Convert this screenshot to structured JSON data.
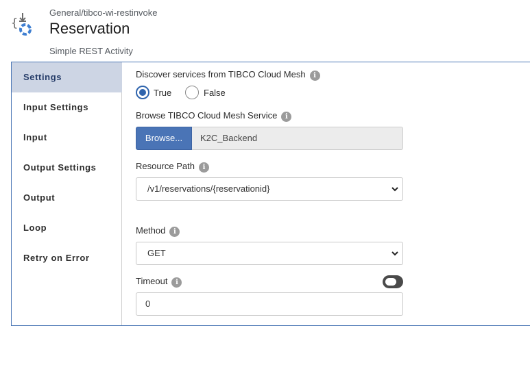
{
  "header": {
    "breadcrumb": "General/tibco-wi-restinvoke",
    "title": "Reservation",
    "subtitle": "Simple REST Activity"
  },
  "sidebar": {
    "items": [
      {
        "label": "Settings",
        "active": true
      },
      {
        "label": "Input Settings",
        "active": false
      },
      {
        "label": "Input",
        "active": false
      },
      {
        "label": "Output Settings",
        "active": false
      },
      {
        "label": "Output",
        "active": false
      },
      {
        "label": "Loop",
        "active": false
      },
      {
        "label": "Retry on Error",
        "active": false
      }
    ]
  },
  "settings": {
    "discover_label": "Discover services from TIBCO Cloud Mesh",
    "discover_options": {
      "true_label": "True",
      "false_label": "False",
      "selected": "True"
    },
    "browse_label": "Browse TIBCO Cloud Mesh Service",
    "browse_button": "Browse...",
    "browse_value": "K2C_Backend",
    "resource_path_label": "Resource Path",
    "resource_path_value": "/v1/reservations/{reservationid}",
    "method_label": "Method",
    "method_value": "GET",
    "timeout_label": "Timeout",
    "timeout_value": "0",
    "timeout_toggle_on": false
  },
  "icons": {
    "info": "info-icon",
    "app": "rest-invoke-icon",
    "dropdown": "chevron-down-icon"
  },
  "colors": {
    "accent": "#4a74b6",
    "panel_border": "#4a76b5",
    "active_nav_bg": "#cdd5e4"
  }
}
